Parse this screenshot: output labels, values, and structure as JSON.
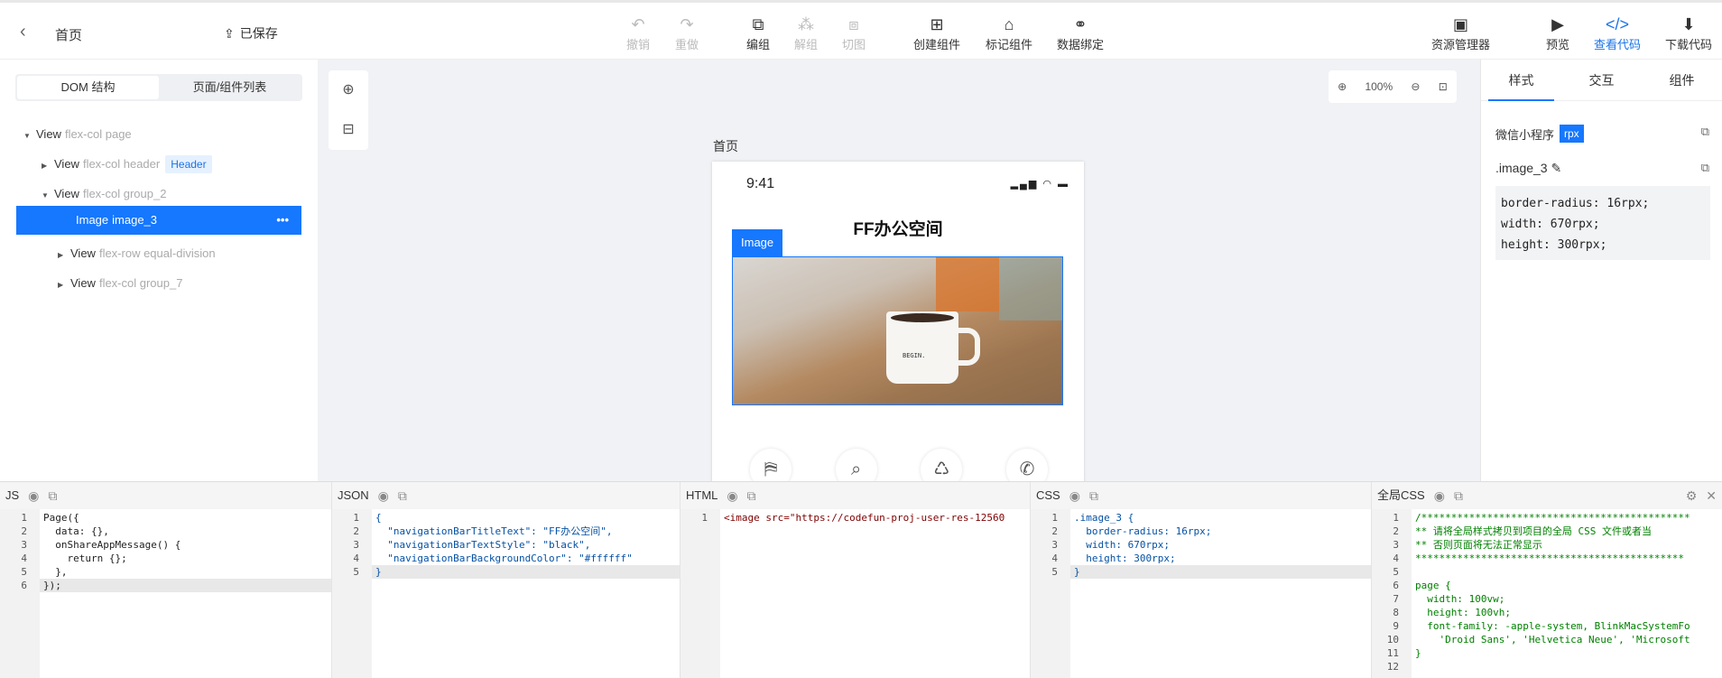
{
  "header": {
    "page_title": "首页",
    "saved": "已保存",
    "tools": [
      {
        "label": "撤销"
      },
      {
        "label": "重做"
      },
      {
        "label": "编组"
      },
      {
        "label": "解组"
      },
      {
        "label": "切图"
      },
      {
        "label": "创建组件"
      },
      {
        "label": "标记组件"
      },
      {
        "label": "数据绑定"
      }
    ],
    "right_tools": [
      {
        "label": "资源管理器"
      },
      {
        "label": "预览"
      },
      {
        "label": "查看代码"
      },
      {
        "label": "下载代码"
      }
    ]
  },
  "sidebar": {
    "tabs": [
      "DOM 结构",
      "页面/组件列表"
    ],
    "tree": [
      {
        "tag": "View",
        "cls": "flex-col page"
      },
      {
        "tag": "View",
        "cls": "flex-col header",
        "badge": "Header"
      },
      {
        "tag": "View",
        "cls": "flex-col group_2"
      },
      {
        "tag": "Image",
        "cls": "image_3"
      },
      {
        "tag": "View",
        "cls": "flex-row equal-division"
      },
      {
        "tag": "View",
        "cls": "flex-col group_7"
      }
    ]
  },
  "canvas": {
    "zoom": "100%",
    "page_label": "首页",
    "time": "9:41",
    "nav_title": "FF办公空间",
    "image_tag": "Image",
    "mug_text": "BEGIN."
  },
  "right": {
    "tabs": [
      "样式",
      "交互",
      "组件"
    ],
    "platform": "微信小程序",
    "unit": "rpx",
    "selector": ".image_3",
    "css_lines": [
      "border-radius: 16rpx;",
      "width: 670rpx;",
      "height: 300rpx;"
    ]
  },
  "panels": {
    "js": "JS",
    "json": "JSON",
    "html": "HTML",
    "css": "CSS",
    "global": "全局CSS"
  },
  "code": {
    "js": "Page({\n  data: {},\n  onShareAppMessage() {\n    return {};\n  },\n});",
    "json": "{\n  \"navigationBarTitleText\": \"FF办公空间\",\n  \"navigationBarTextStyle\": \"black\",\n  \"navigationBarBackgroundColor\": \"#ffffff\"\n}",
    "html": "<image src=\"https://codefun-proj-user-res-12560",
    "css": ".image_3 {\n  border-radius: 16rpx;\n  width: 670rpx;\n  height: 300rpx;\n}",
    "global": "/*********************************************\n** 请将全局样式拷贝到项目的全局 CSS 文件或者当\n** 否则页面将无法正常显示\n*********************************************\n\npage {\n  width: 100vw;\n  height: 100vh;\n  font-family: -apple-system, BlinkMacSystemFo\n    'Droid Sans', 'Helvetica Neue', 'Microsoft\n}\n\n."
  },
  "colors": {
    "accent": "#1677ff"
  }
}
